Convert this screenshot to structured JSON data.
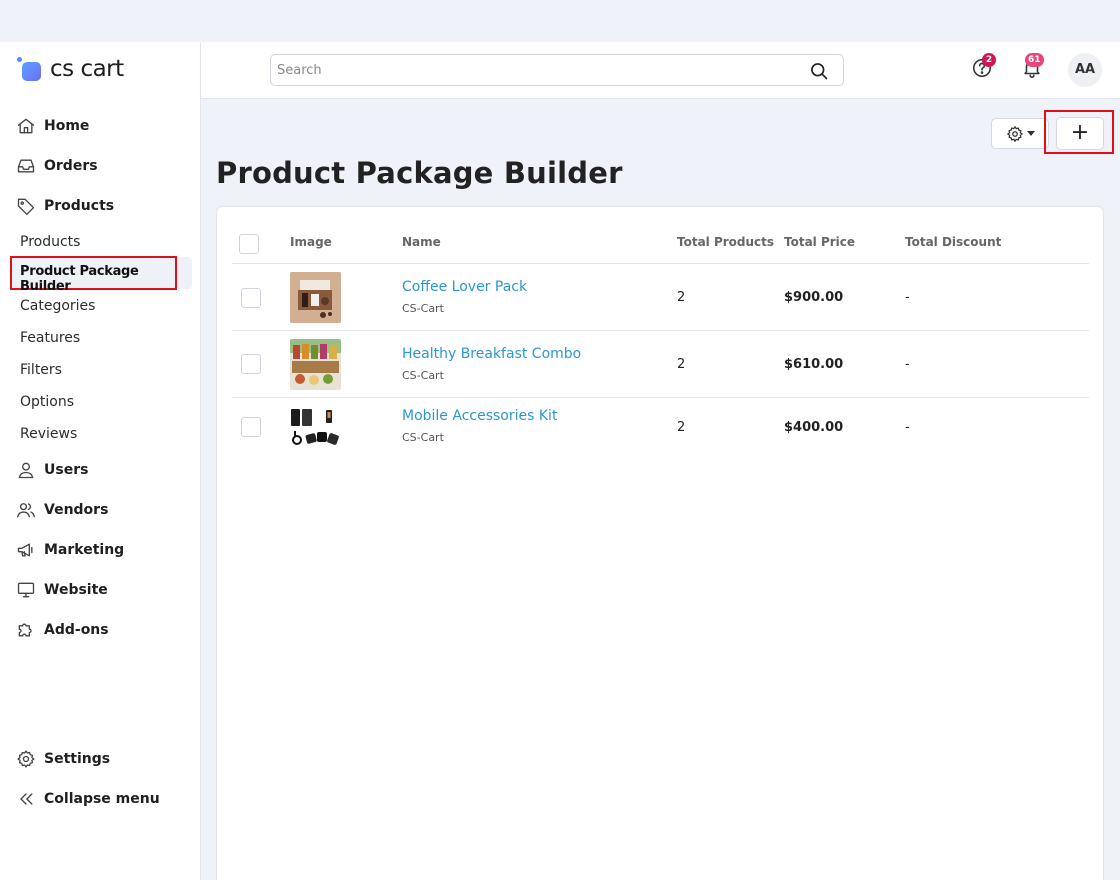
{
  "brand": {
    "name": "cs cart",
    "accent": "#4f8ef7"
  },
  "sidebar": {
    "top_items": [
      {
        "label": "Home",
        "icon": "home-icon"
      },
      {
        "label": "Orders",
        "icon": "inbox-icon"
      },
      {
        "label": "Products",
        "icon": "tag-icon"
      }
    ],
    "sub_items": [
      {
        "label": "Products"
      },
      {
        "label": "Product Package Builder",
        "active": true
      },
      {
        "label": "Categories"
      },
      {
        "label": "Features"
      },
      {
        "label": "Filters"
      },
      {
        "label": "Options"
      },
      {
        "label": "Reviews"
      }
    ],
    "bottom_items": [
      {
        "label": "Users",
        "icon": "user-icon"
      },
      {
        "label": "Vendors",
        "icon": "users-icon"
      },
      {
        "label": "Marketing",
        "icon": "megaphone-icon"
      },
      {
        "label": "Website",
        "icon": "monitor-icon"
      },
      {
        "label": "Add-ons",
        "icon": "puzzle-icon"
      }
    ],
    "footer_items": [
      {
        "label": "Settings",
        "icon": "gear-icon"
      },
      {
        "label": "Collapse menu",
        "icon": "double-chevron-left-icon"
      }
    ]
  },
  "header": {
    "search_placeholder": "Search",
    "help_badge": "2",
    "notifications_badge": "61",
    "avatar_initials": "AA"
  },
  "toolbar": {
    "add_label": "+"
  },
  "page": {
    "title": "Product Package Builder"
  },
  "table": {
    "columns": [
      "Image",
      "Name",
      "Total Products",
      "Total Price",
      "Total Discount"
    ],
    "rows": [
      {
        "name": "Coffee Lover Pack",
        "vendor": "CS-Cart",
        "total_products": "2",
        "total_price": "$900.00",
        "total_discount": "-"
      },
      {
        "name": "Healthy Breakfast Combo",
        "vendor": "CS-Cart",
        "total_products": "2",
        "total_price": "$610.00",
        "total_discount": "-"
      },
      {
        "name": "Mobile Accessories Kit",
        "vendor": "CS-Cart",
        "total_products": "2",
        "total_price": "$400.00",
        "total_discount": "-"
      }
    ]
  },
  "colors": {
    "link": "#2b97cf",
    "highlight": "#e0101a",
    "badge": "#d21653"
  }
}
